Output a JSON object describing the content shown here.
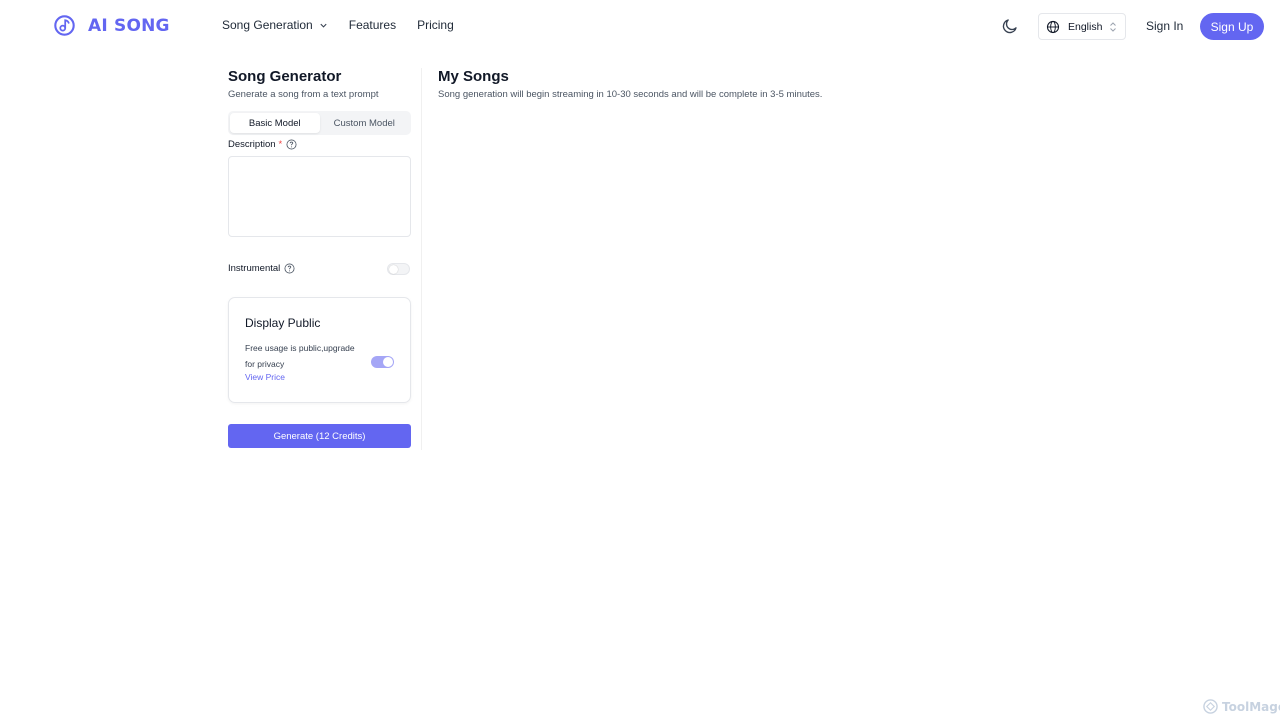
{
  "brand": {
    "name": "AI SONG",
    "color": "#6366f1"
  },
  "nav": {
    "items": [
      {
        "label": "Song Generation",
        "has_dropdown": true
      },
      {
        "label": "Features"
      },
      {
        "label": "Pricing"
      }
    ]
  },
  "header": {
    "language": "English",
    "sign_in": "Sign In",
    "sign_up": "Sign Up"
  },
  "generator": {
    "title": "Song Generator",
    "subtitle": "Generate a song from a text prompt",
    "tabs": [
      {
        "label": "Basic Model",
        "active": true
      },
      {
        "label": "Custom Model",
        "active": false
      }
    ],
    "description_label": "Description",
    "required_mark": "*",
    "description_value": "",
    "instrumental_label": "Instrumental",
    "instrumental_on": false,
    "display_public": {
      "title": "Display Public",
      "text": "Free usage is public,upgrade for privacy",
      "link": "View Price",
      "enabled": true
    },
    "generate_label": "Generate (12 Credits)"
  },
  "songs": {
    "title": "My Songs",
    "subtitle": "Song generation will begin streaming in 10-30 seconds and will be complete in 3-5 minutes."
  },
  "watermark": {
    "text": "ToolMage"
  }
}
